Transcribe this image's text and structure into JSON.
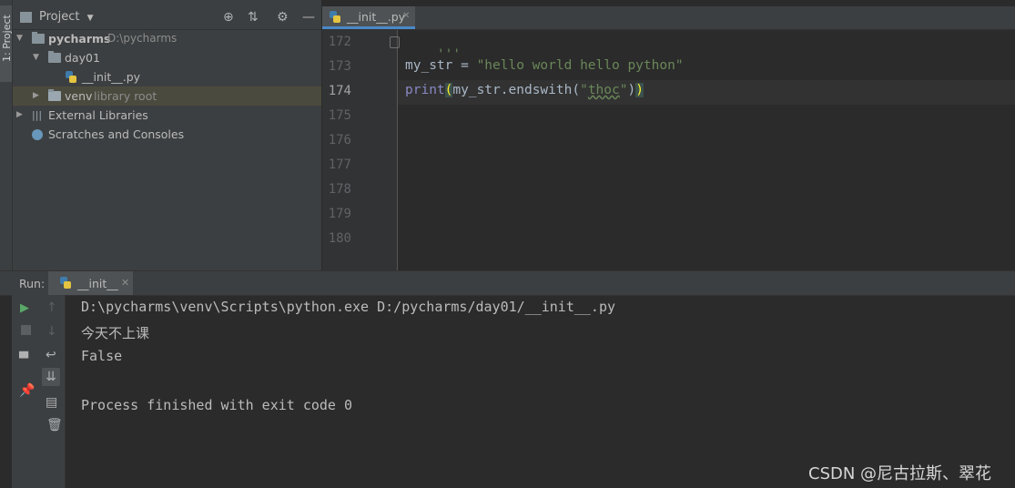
{
  "sidebar_strip": {
    "project_tab": "1: Project"
  },
  "project": {
    "header_title": "Project",
    "tree": {
      "root_name": "pycharms",
      "root_path": "D:\\pycharms",
      "folder_day01": "day01",
      "file_init": "__init__.py",
      "folder_venv": "venv",
      "venv_tag": "library root",
      "external_libs": "External Libraries",
      "scratches": "Scratches and Consoles"
    }
  },
  "editor": {
    "tab_label": "__init__.py",
    "line_numbers": [
      "172",
      "173",
      "174",
      "175",
      "176",
      "177",
      "178",
      "179",
      "180"
    ],
    "current_line": "174",
    "code": {
      "l172": "'''",
      "l173_var": "my_str = ",
      "l173_str": "\"hello world hello python\"",
      "l174_print": "print",
      "l174_open": "(",
      "l174_mid": "my_str.endswith(",
      "l174_q1": "\"",
      "l174_word": "thoc",
      "l174_q2": "\"",
      "l174_close_inner": ")",
      "l174_close": ")"
    }
  },
  "run": {
    "title": "Run:",
    "tab_label": "__init__",
    "output": [
      "D:\\pycharms\\venv\\Scripts\\python.exe D:/pycharms/day01/__init__.py",
      "今天不上课",
      "False",
      "",
      "Process finished with exit code 0"
    ]
  },
  "watermark": "CSDN @尼古拉斯、翠花",
  "colors": {
    "accent_tab": "#4a88c7",
    "string": "#6a8759",
    "builtin": "#8888c6",
    "brace_highlight": "#ffef28",
    "run_green": "#59a869"
  }
}
